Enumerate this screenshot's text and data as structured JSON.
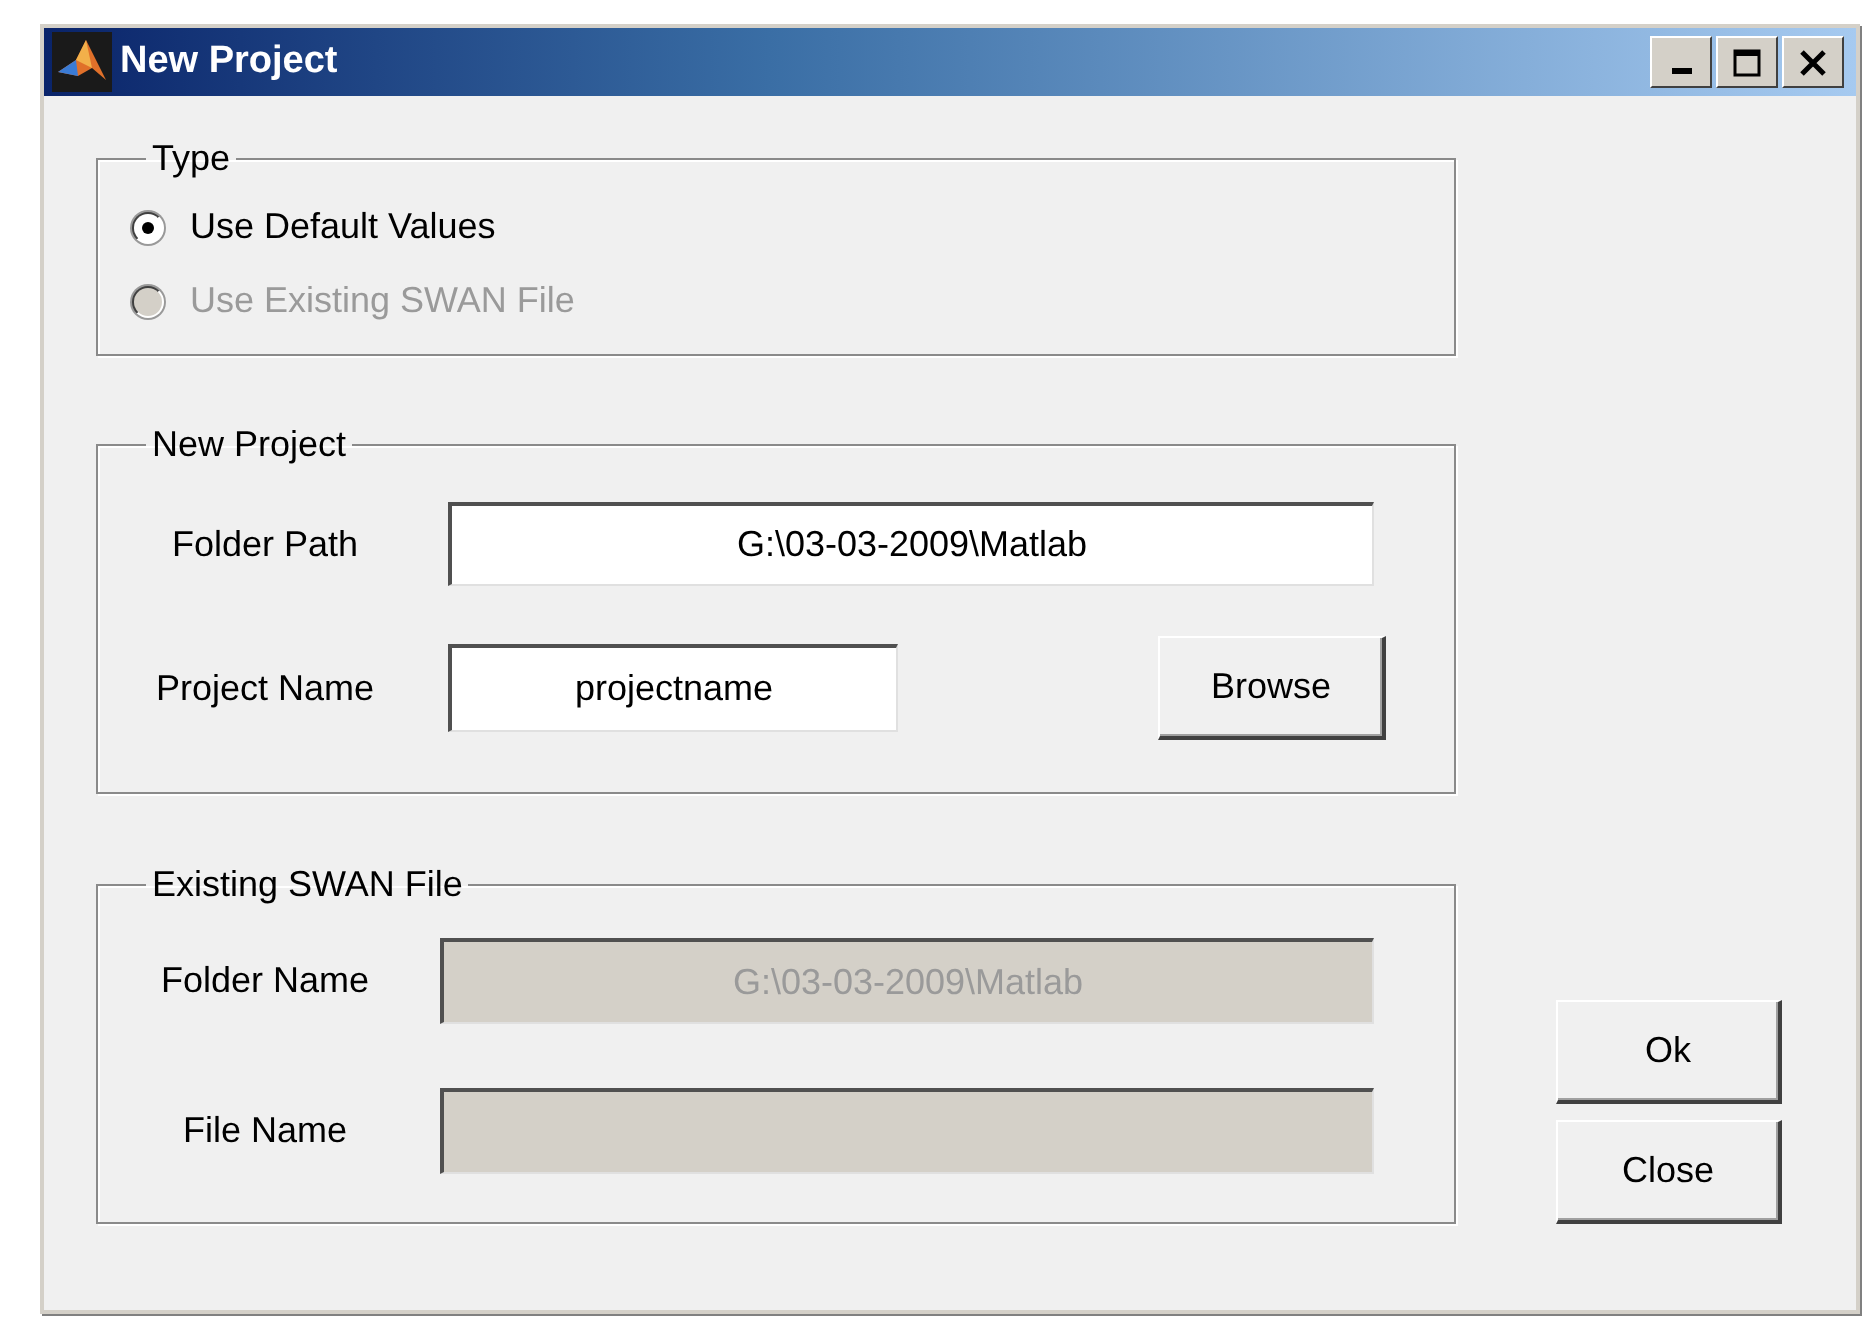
{
  "window": {
    "title": "New Project"
  },
  "type_group": {
    "title": "Type",
    "options": [
      {
        "label": "Use Default Values",
        "selected": true,
        "disabled": false
      },
      {
        "label": "Use Existing SWAN File",
        "selected": false,
        "disabled": true
      }
    ]
  },
  "new_project": {
    "title": "New Project",
    "fields": [
      {
        "label": "Folder Path",
        "value": "G:\\03-03-2009\\Matlab",
        "disabled": false
      },
      {
        "label": "Project Name",
        "value": "projectname",
        "disabled": false
      }
    ],
    "browse_button": "Browse"
  },
  "existing": {
    "title": "Existing SWAN File",
    "fields": [
      {
        "label": "Folder Name",
        "value": "G:\\03-03-2009\\Matlab",
        "disabled": true
      },
      {
        "label": "File Name",
        "disabled": true
      }
    ]
  },
  "buttons": [
    "Ok",
    "Close"
  ]
}
